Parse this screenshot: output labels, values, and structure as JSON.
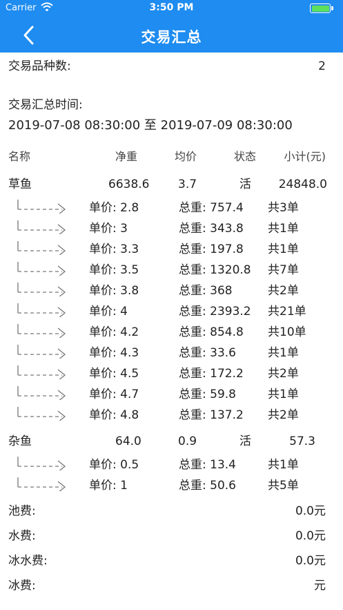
{
  "status": {
    "carrier": "Carrier",
    "time": "3:50 PM"
  },
  "nav": {
    "title": "交易汇总",
    "back_icon": "chevron-left-icon"
  },
  "summary": {
    "varieties_label": "交易品种数:",
    "varieties_value": "2",
    "time_label": "交易汇总时间:",
    "time_range": "2019-07-08 08:30:00 至 2019-07-09 08:30:00"
  },
  "table": {
    "headers": {
      "name": "名称",
      "net_weight": "净重",
      "avg_price": "均价",
      "status": "状态",
      "subtotal": "小计(元)"
    },
    "items": [
      {
        "name": "草鱼",
        "net_weight": "6638.6",
        "avg_price": "3.7",
        "status": "活",
        "subtotal": "24848.0",
        "details": [
          {
            "price": "单价: 2.8",
            "weight": "总重: 757.4",
            "count": "共3单"
          },
          {
            "price": "单价: 3",
            "weight": "总重: 343.8",
            "count": "共1单"
          },
          {
            "price": "单价: 3.3",
            "weight": "总重: 197.8",
            "count": "共1单"
          },
          {
            "price": "单价: 3.5",
            "weight": "总重: 1320.8",
            "count": "共7单"
          },
          {
            "price": "单价: 3.8",
            "weight": "总重: 368",
            "count": "共2单"
          },
          {
            "price": "单价: 4",
            "weight": "总重: 2393.2",
            "count": "共21单"
          },
          {
            "price": "单价: 4.2",
            "weight": "总重: 854.8",
            "count": "共10单"
          },
          {
            "price": "单价: 4.3",
            "weight": "总重: 33.6",
            "count": "共1单"
          },
          {
            "price": "单价: 4.5",
            "weight": "总重: 172.2",
            "count": "共2单"
          },
          {
            "price": "单价: 4.7",
            "weight": "总重: 59.8",
            "count": "共1单"
          },
          {
            "price": "单价: 4.8",
            "weight": "总重: 137.2",
            "count": "共2单"
          }
        ]
      },
      {
        "name": "杂鱼",
        "net_weight": "64.0",
        "avg_price": "0.9",
        "status": "活",
        "subtotal": "57.3",
        "details": [
          {
            "price": "单价: 0.5",
            "weight": "总重: 13.4",
            "count": "共1单"
          },
          {
            "price": "单价: 1",
            "weight": "总重: 50.6",
            "count": "共5单"
          }
        ]
      }
    ]
  },
  "fees": [
    {
      "label": "池费:",
      "value": "0.0元"
    },
    {
      "label": "水费:",
      "value": "0.0元"
    },
    {
      "label": "冰水费:",
      "value": "0.0元"
    },
    {
      "label": "冰费:",
      "value": "元"
    }
  ]
}
